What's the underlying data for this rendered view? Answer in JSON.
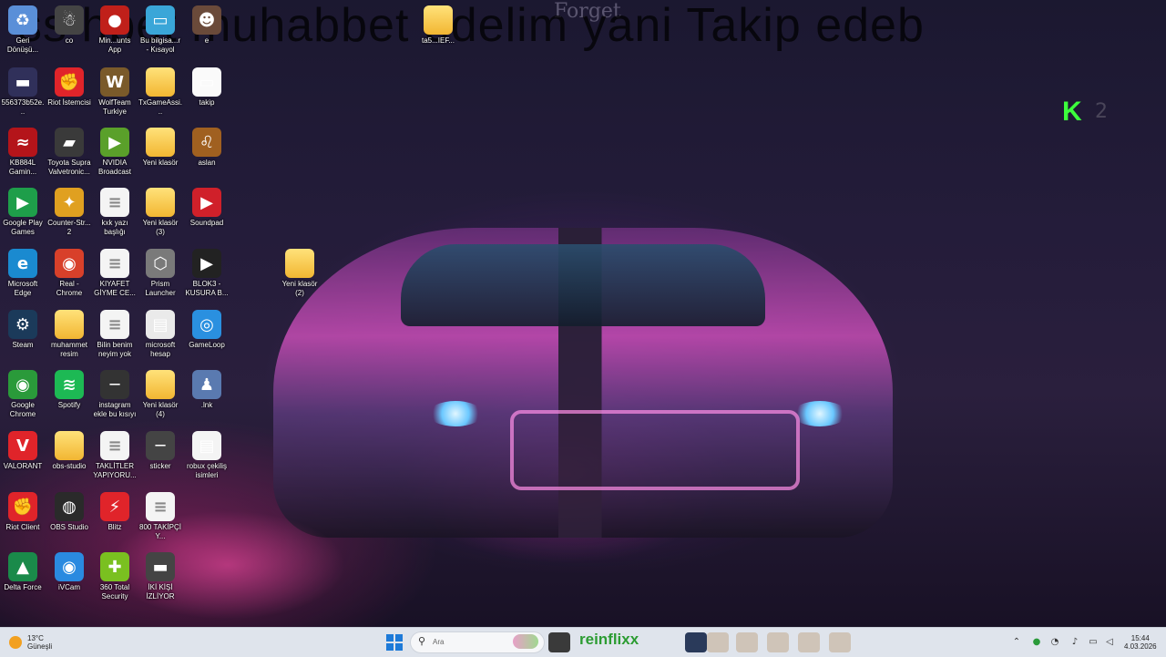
{
  "wallpaper": {
    "overlay_text": "...sohbet muhabbet edelim yani Takip edeb...",
    "overlay_text_display": "ss hbet muhabbet edelim yani Takip edeb",
    "forget_label": "Forget",
    "k_logo": "K",
    "k_num": "2"
  },
  "desktop_icons": [
    {
      "id": "geri-donusum",
      "label": "Geri Dönüşü...",
      "glyph": "♻",
      "color": "#5a8fd8"
    },
    {
      "id": "co",
      "label": "co",
      "glyph": "☃",
      "color": "#444"
    },
    {
      "id": "minecraft",
      "label": "Min...unts App",
      "glyph": "●",
      "color": "#c0201a"
    },
    {
      "id": "bu-bilgisayar",
      "label": "Bu bilgisa...r - Kısayol",
      "glyph": "▭",
      "color": "#3aa6d8"
    },
    {
      "id": "icon-e",
      "label": "e",
      "glyph": "☻",
      "color": "#6a4a3a"
    },
    {
      "id": "ta5-ief",
      "label": "ta5...IEF...",
      "glyph": "",
      "color": "folder"
    },
    {
      "id": "img-556",
      "label": "556373b52e...",
      "glyph": "▬",
      "color": "#30305a"
    },
    {
      "id": "riot-istemcisi",
      "label": "Riot İstemcisi",
      "glyph": "✊",
      "color": "#e0242a"
    },
    {
      "id": "wolfteam",
      "label": "WolfTeam Turkiye",
      "glyph": "W",
      "color": "#7a5a2a"
    },
    {
      "id": "txgameassi",
      "label": "TxGameAssi...",
      "glyph": "",
      "color": "folder"
    },
    {
      "id": "takip",
      "label": "takip",
      "glyph": "▭",
      "color": "#fafafa"
    },
    {
      "id": "kb884l",
      "label": "KB884L Gamin...",
      "glyph": "≈",
      "color": "#b4141a"
    },
    {
      "id": "toyota-supra",
      "label": "Toyota Supra Valvetronic...",
      "glyph": "▰",
      "color": "#3a3a3a"
    },
    {
      "id": "nvidia-broadcast",
      "label": "NVIDIA Broadcast",
      "glyph": "▶",
      "color": "#5aa02a"
    },
    {
      "id": "yeni-klasor",
      "label": "Yeni klasör",
      "glyph": "",
      "color": "folder"
    },
    {
      "id": "aslan",
      "label": "aslan",
      "glyph": "♌",
      "color": "#a06020"
    },
    {
      "id": "google-play-games",
      "label": "Google Play Games",
      "glyph": "▶",
      "color": "#1e9e4a"
    },
    {
      "id": "counter-strike",
      "label": "Counter-Str... 2",
      "glyph": "✦",
      "color": "#e0a020"
    },
    {
      "id": "kxk-yazi",
      "label": "kxk yazı başlığı",
      "glyph": "≡",
      "color": "doc"
    },
    {
      "id": "yeni-klasor-3",
      "label": "Yeni klasör (3)",
      "glyph": "",
      "color": "folder"
    },
    {
      "id": "soundpad",
      "label": "Soundpad",
      "glyph": "▶",
      "color": "#d0202a"
    },
    {
      "id": "microsoft-edge",
      "label": "Microsoft Edge",
      "glyph": "e",
      "color": "#1a8ad0"
    },
    {
      "id": "real-chrome",
      "label": "Real - Chrome",
      "glyph": "◉",
      "color": "#d8402a"
    },
    {
      "id": "kiyafet",
      "label": "KIYAFET GİYME CE...",
      "glyph": "≡",
      "color": "doc"
    },
    {
      "id": "prism-launcher",
      "label": "Prism Launcher",
      "glyph": "⬡",
      "color": "#7a7a7a"
    },
    {
      "id": "blok3",
      "label": "BLOK3 - KUSURA B...",
      "glyph": "▶",
      "color": "#222"
    },
    {
      "id": "yeni-klasor-2",
      "label": "Yeni klasör (2)",
      "glyph": "",
      "color": "folder"
    },
    {
      "id": "steam",
      "label": "Steam",
      "glyph": "⚙",
      "color": "#1b3a5a"
    },
    {
      "id": "muhammet-resim",
      "label": "muhammet resim",
      "glyph": "",
      "color": "folder"
    },
    {
      "id": "bilin-benim",
      "label": "Bilin benim neyim yok",
      "glyph": "≡",
      "color": "doc"
    },
    {
      "id": "microsoft-hesap",
      "label": "microsoft hesap",
      "glyph": "▤",
      "color": "#eaeaea"
    },
    {
      "id": "gameloop",
      "label": "GameLoop",
      "glyph": "◎",
      "color": "#2a90e0"
    },
    {
      "id": "google-chrome",
      "label": "Google Chrome",
      "glyph": "◉",
      "color": "#2a9a3a"
    },
    {
      "id": "spotify",
      "label": "Spotify",
      "glyph": "≋",
      "color": "#1db954"
    },
    {
      "id": "instagram",
      "label": "instagram ekle bu kısıyı",
      "glyph": "─",
      "color": "#333"
    },
    {
      "id": "yeni-klasor-4",
      "label": "Yeni klasör (4)",
      "glyph": "",
      "color": "folder"
    },
    {
      "id": "lnk",
      "label": ".lnk",
      "glyph": "♟",
      "color": "#5a7ab0"
    },
    {
      "id": "valorant",
      "label": "VALORANT",
      "glyph": "V",
      "color": "#e0242a"
    },
    {
      "id": "obs-studio-folder",
      "label": "obs-studio",
      "glyph": "",
      "color": "folder"
    },
    {
      "id": "taklitler",
      "label": "TAKLİTLER YAPIYORU...",
      "glyph": "≡",
      "color": "doc"
    },
    {
      "id": "sticker",
      "label": "sticker",
      "glyph": "─",
      "color": "#444"
    },
    {
      "id": "robux",
      "label": "robux çekiliş isimleri",
      "glyph": "▤",
      "color": "#f4f4f4"
    },
    {
      "id": "riot-client",
      "label": "Riot Client",
      "glyph": "✊",
      "color": "#e0242a"
    },
    {
      "id": "obs-studio",
      "label": "OBS Studio",
      "glyph": "◍",
      "color": "#2a2a2a"
    },
    {
      "id": "blitz",
      "label": "Blitz",
      "glyph": "⚡",
      "color": "#e0242a"
    },
    {
      "id": "800-takipci",
      "label": "800 TAKİPÇİ Y...",
      "glyph": "≡",
      "color": "doc"
    },
    {
      "id": "delta-force",
      "label": "Delta Force",
      "glyph": "▲",
      "color": "#1a8a4a"
    },
    {
      "id": "ivcam",
      "label": "iVCam",
      "glyph": "◉",
      "color": "#2a8ae0"
    },
    {
      "id": "360-total",
      "label": "360 Total Security",
      "glyph": "✚",
      "color": "#7ac020"
    },
    {
      "id": "iki-kisi",
      "label": "İKİ KİŞİ İZLİYOR",
      "glyph": "▬",
      "color": "#444"
    }
  ],
  "taskbar": {
    "weather_temp": "13°C",
    "weather_desc": "Güneşli",
    "search_placeholder": "Ara",
    "reinflixx": "reinflixx",
    "clock_time": "15:44",
    "clock_date": "4.03.2026"
  }
}
